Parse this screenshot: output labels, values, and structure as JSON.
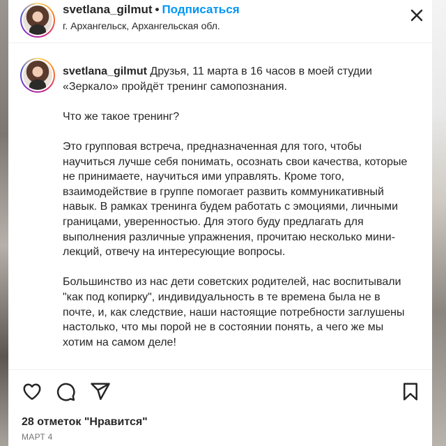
{
  "post": {
    "username": "svetlana_gilmut",
    "separator": "•",
    "follow_label": "Подписаться",
    "location": "г. Архангельск, Архангельская обл.",
    "caption_username": "svetlana_gilmut",
    "caption_paragraphs": [
      "Друзья, 11 марта в 16 часов в моей студии «Зеркало» пройдёт тренинг самопознания.",
      "Что же такое тренинг?",
      "Это групповая встреча, предназначенная для того, чтобы научиться лучше себя понимать, осознать свои качества, которые не принимаете, научиться ими управлять. Кроме того, взаимодействие в группе помогает развить коммуникативный навык. В рамках тренинга будем работать с эмоциями, личными границами, уверенностью. Для этого буду предлагать для выполнения различные упражнения, прочитаю несколько мини-лекций, отвечу на интересующие вопросы.",
      "Большинство из нас дети советских родителей, нас воспитывали \"как под копирку\", индивидуальность в те времена была не в почте, и, как следствие, наши настоящие потребности заглушены настолько, что мы порой не в состоянии понять, а чего же мы хотим на самом деле!"
    ],
    "likes_text": "28 отметок \"Нравится\"",
    "date_text": "МАРТ 4"
  },
  "icons": {
    "more": "more-horizontal-icon",
    "like": "heart-icon",
    "comment": "comment-icon",
    "share": "send-icon",
    "save": "bookmark-icon"
  },
  "colors": {
    "follow": "#0095f6",
    "text": "#262626",
    "muted": "#737373"
  }
}
